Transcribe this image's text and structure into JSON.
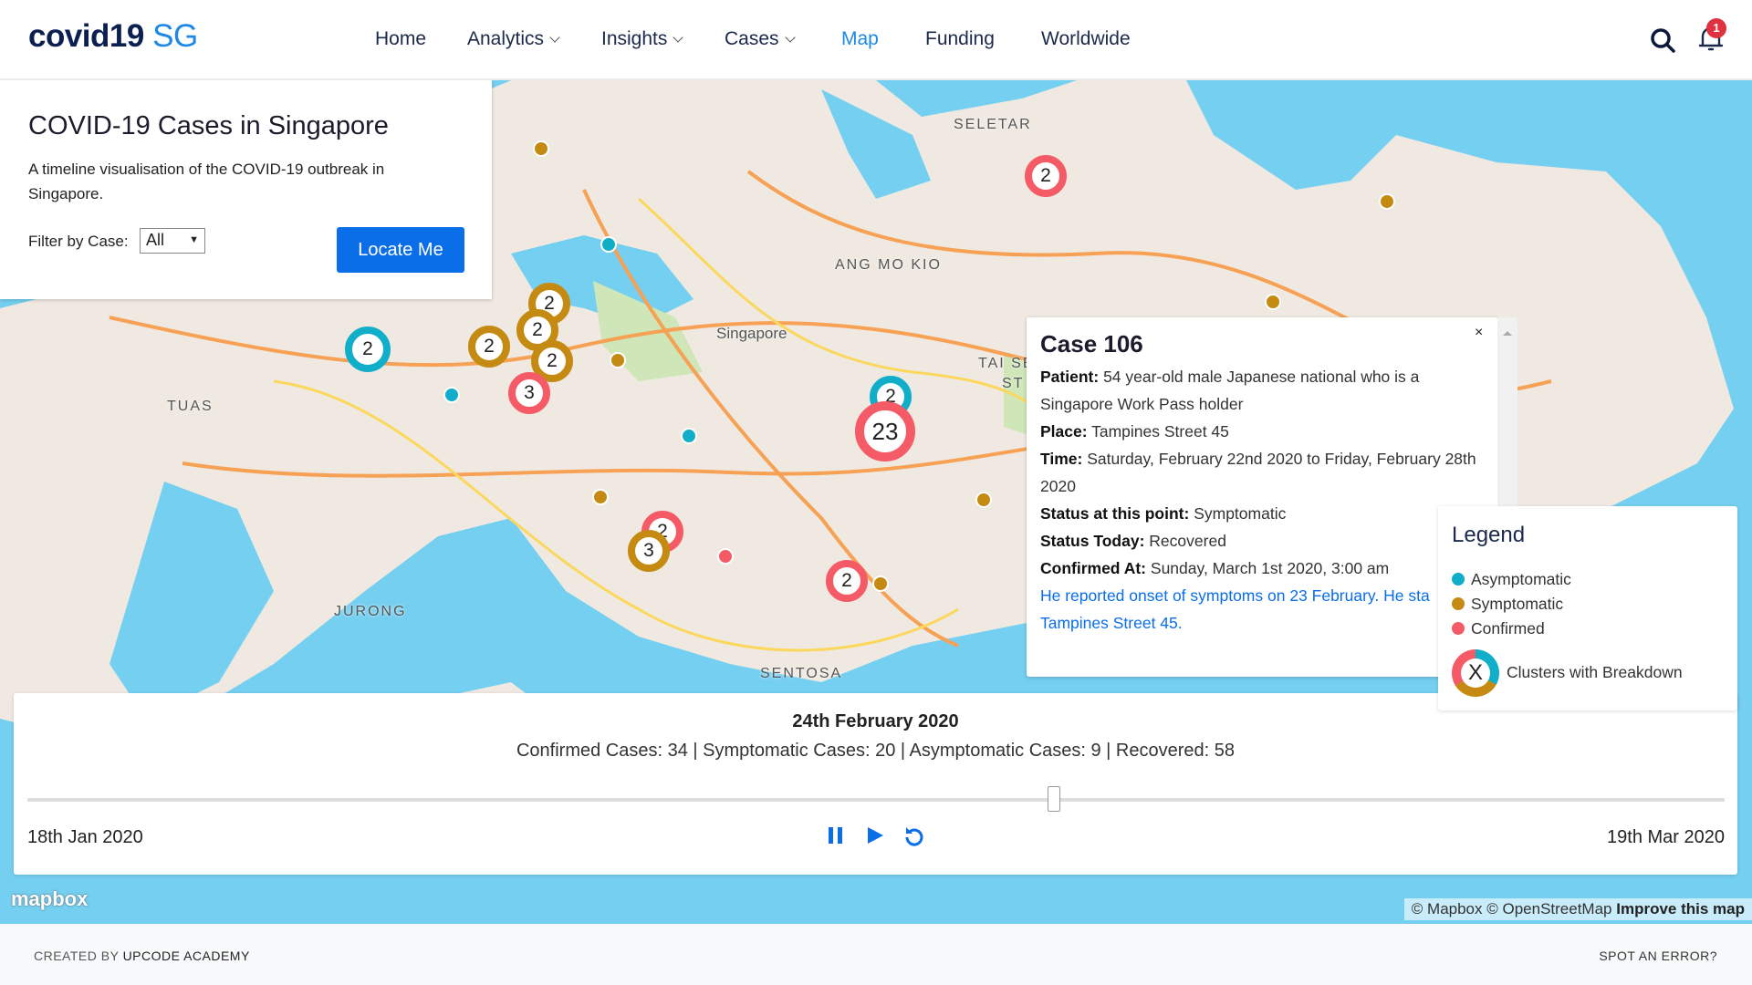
{
  "header": {
    "logo_main": "covid19",
    "logo_accent": "SG",
    "nav": [
      {
        "label": "Home"
      },
      {
        "label": "Analytics"
      },
      {
        "label": "Insights"
      },
      {
        "label": "Cases"
      },
      {
        "label": "Map"
      },
      {
        "label": "Funding"
      },
      {
        "label": "Worldwide"
      }
    ],
    "active": "Map",
    "notification_count": "1"
  },
  "info": {
    "title": "COVID-19 Cases in Singapore",
    "description": "A timeline visualisation of the COVID-19 outbreak in Singapore.",
    "filter_label": "Filter by Case:",
    "filter_value": "All",
    "locate_label": "Locate Me"
  },
  "map": {
    "labels": [
      "SELETAR",
      "ANG MO KIO",
      "Singapore",
      "TUAS",
      "JURONG",
      "SENTOSA",
      "TAI SE",
      "ST"
    ],
    "clusters": [
      "2",
      "2",
      "2",
      "2",
      "2",
      "3",
      "2",
      "2",
      "23",
      "2",
      "3",
      "2"
    ],
    "colors": {
      "asymptomatic": "#11aeca",
      "symptomatic": "#c48a12",
      "confirmed": "#f45b66"
    }
  },
  "popup": {
    "title": "Case 106",
    "patient_label": "Patient:",
    "patient": "54 year-old male Japanese national who is a Singapore Work Pass holder",
    "place_label": "Place:",
    "place": "Tampines Street 45",
    "time_label": "Time:",
    "time": "Saturday, February 22nd 2020 to Friday, February 28th 2020",
    "status_label": "Status at this point:",
    "status": "Symptomatic",
    "today_label": "Status Today:",
    "today": "Recovered",
    "confirmed_label": "Confirmed At:",
    "confirmed": "Sunday, March 1st 2020, 3:00 am",
    "note_1": "He reported onset of symptoms on 23 February. He sta",
    "note_2": "Tampines Street 45.",
    "close": "×"
  },
  "legend": {
    "title": "Legend",
    "items": [
      {
        "label": "Asymptomatic"
      },
      {
        "label": "Symptomatic"
      },
      {
        "label": "Confirmed"
      }
    ],
    "cluster_label": "Clusters with Breakdown",
    "cluster_symbol": "X"
  },
  "timeline": {
    "date": "24th February 2020",
    "stats": "Confirmed Cases: 34 | Symptomatic Cases: 20 | Asymptomatic Cases: 9 | Recovered: 58",
    "start": "18th Jan 2020",
    "end": "19th Mar 2020",
    "progress": 0.605
  },
  "attribution": {
    "mapbox": "mapbox",
    "text": "© Mapbox © OpenStreetMap",
    "improve": "Improve this map"
  },
  "footer": {
    "created_by": "CREATED BY",
    "org": "UPCODE ACADEMY",
    "error": "SPOT AN ERROR?"
  }
}
